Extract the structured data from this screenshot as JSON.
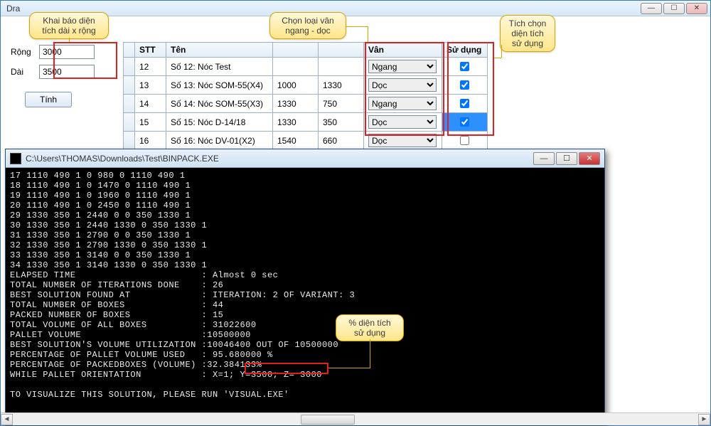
{
  "window": {
    "title": "Dra"
  },
  "callouts": {
    "dim": "Khai báo diện\ntích dài x rộng",
    "van": "Chọn loại vân\nngang - dọc",
    "use": "Tích chọn\ndiện tích\nsử dụng",
    "pct": "% diện tích\nsử dụng"
  },
  "left": {
    "rong_label": "Rộng",
    "rong_value": "3000",
    "dai_label": "Dài",
    "dai_value": "3500",
    "tinh_label": "Tính"
  },
  "grid": {
    "headers": {
      "stt": "STT",
      "ten": "Tên",
      "a": "",
      "b": "",
      "van": "Vân",
      "sd": "Sử dụng"
    },
    "van_options": [
      "Ngang",
      "Dọc"
    ],
    "rows": [
      {
        "stt": "12",
        "ten": "Số 12: Nóc Test",
        "a": "",
        "b": "",
        "van": "Ngang",
        "sd": true,
        "sel": false
      },
      {
        "stt": "13",
        "ten": "Số 13: Nóc SOM-55(X4)",
        "a": "1000",
        "b": "1330",
        "van": "Dọc",
        "sd": true,
        "sel": false
      },
      {
        "stt": "14",
        "ten": "Số 14: Nóc SOM-55(X3)",
        "a": "1330",
        "b": "750",
        "van": "Ngang",
        "sd": true,
        "sel": false
      },
      {
        "stt": "15",
        "ten": "Số 15: Nóc D-14/18",
        "a": "1330",
        "b": "350",
        "van": "Dọc",
        "sd": true,
        "sel": true
      },
      {
        "stt": "16",
        "ten": "Số 16: Nóc DV-01(X2)",
        "a": "1540",
        "b": "660",
        "van": "Dọc",
        "sd": false,
        "sel": false
      }
    ]
  },
  "console": {
    "title": "C:\\Users\\THOMAS\\Downloads\\Test\\BINPACK.EXE",
    "lines": [
      "17 1110 490 1 0 980 0 1110 490 1",
      "18 1110 490 1 0 1470 0 1110 490 1",
      "19 1110 490 1 0 1960 0 1110 490 1",
      "20 1110 490 1 0 2450 0 1110 490 1",
      "29 1330 350 1 2440 0 0 350 1330 1",
      "30 1330 350 1 2440 1330 0 350 1330 1",
      "31 1330 350 1 2790 0 0 350 1330 1",
      "32 1330 350 1 2790 1330 0 350 1330 1",
      "33 1330 350 1 3140 0 0 350 1330 1",
      "34 1330 350 1 3140 1330 0 350 1330 1",
      "ELAPSED TIME                       : Almost 0 sec",
      "TOTAL NUMBER OF ITERATIONS DONE    : 26",
      "BEST SOLUTION FOUND AT             : ITERATION: 2 OF VARIANT: 3",
      "TOTAL NUMBER OF BOXES              : 44",
      "PACKED NUMBER OF BOXES             : 15",
      "TOTAL VOLUME OF ALL BOXES          : 31022600",
      "PALLET VOLUME                      :10500000",
      "BEST SOLUTION'S VOLUME UTILIZATION :10046400 OUT OF 10500000",
      "PERCENTAGE OF PALLET VOLUME USED   : 95.680000 %",
      "PERCENTAGE OF PACKEDBOXES (VOLUME) :32.384133%",
      "WHILE PALLET ORIENTATION           : X=1; Y=3500; Z= 3000",
      "",
      "TO VISUALIZE THIS SOLUTION, PLEASE RUN 'VISUAL.EXE'",
      ""
    ],
    "highlight_value": "95.680000 %"
  }
}
